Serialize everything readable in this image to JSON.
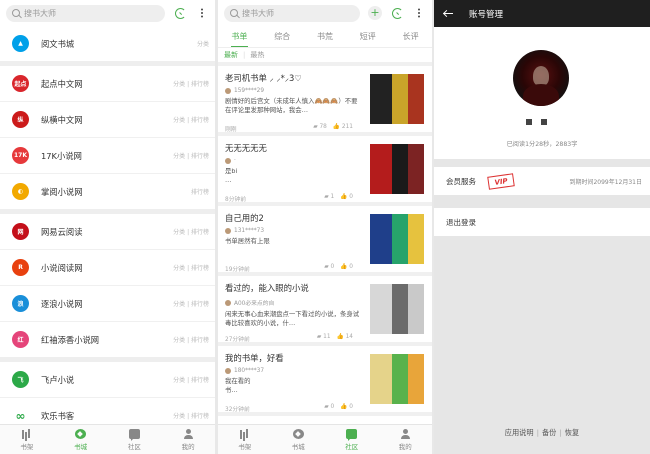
{
  "search_placeholder": "搜书大师",
  "panel1": {
    "sources": [
      {
        "name": "阅文书城",
        "tags": "分类",
        "color": "#00a0e9",
        "logo": "▲"
      },
      {
        "name": "起点中文网",
        "tags": "分类 | 排行榜",
        "color": "#d9262c",
        "logo": "起点"
      },
      {
        "name": "纵横中文网",
        "tags": "分类 | 排行榜",
        "color": "#cc1b1b",
        "logo": "纵"
      },
      {
        "name": "17K小说网",
        "tags": "分类 | 排行榜",
        "color": "#e6393b",
        "logo": "17K"
      },
      {
        "name": "掌阅小说网",
        "tags": "排行榜",
        "color": "#f2a900",
        "logo": "◐"
      },
      {
        "name": "网易云阅读",
        "tags": "分类 | 排行榜",
        "color": "#c40f1a",
        "logo": "网"
      },
      {
        "name": "小说阅读网",
        "tags": "分类 | 排行榜",
        "color": "#e8410f",
        "logo": "R"
      },
      {
        "name": "逐浪小说网",
        "tags": "分类 | 排行榜",
        "color": "#1a8fd9",
        "logo": "浪"
      },
      {
        "name": "红袖添香小说网",
        "tags": "分类 | 排行榜",
        "color": "#e5457a",
        "logo": "红"
      },
      {
        "name": "飞卢小说",
        "tags": "分类 | 排行榜",
        "color": "#2ca948",
        "logo": "飞"
      },
      {
        "name": "欢乐书客",
        "tags": "分类 | 排行榜",
        "color": "#ffffff",
        "logo": "∞"
      }
    ],
    "nav": [
      {
        "label": "书架",
        "icon": "shelf"
      },
      {
        "label": "书城",
        "icon": "city"
      },
      {
        "label": "社区",
        "icon": "comm"
      },
      {
        "label": "我的",
        "icon": "me"
      }
    ],
    "active_nav": 1
  },
  "panel2": {
    "tabs": [
      "书单",
      "综合",
      "书荒",
      "短评",
      "长评"
    ],
    "active_tab": 0,
    "subtabs": [
      "最新",
      "最热"
    ],
    "posts": [
      {
        "title": "老司机书单 ⸝ ⸝*⸝3♡",
        "user": "159****29",
        "desc": "剧情好的后宫文（未成年人慎入🙈🙈🙈）不要在评论里发那种网站，我会…",
        "time": "刚刚",
        "count1": "78",
        "count2": "211",
        "covers": [
          "#222",
          "#c9a42a",
          "#a9341f"
        ]
      },
      {
        "title": "无无无无无",
        "user": "·",
        "desc": "是bi\n…",
        "time": "8分钟前",
        "count1": "1",
        "count2": "0",
        "covers": [
          "#b41c1c",
          "#1a1a1a",
          "#7c2323"
        ]
      },
      {
        "title": "自己用的2",
        "user": "131****73",
        "desc": "书单居然有上限",
        "time": "19分钟前",
        "count1": "0",
        "count2": "0",
        "covers": [
          "#1f3f8a",
          "#27a36b",
          "#e6c23e"
        ]
      },
      {
        "title": "看过的，能入眼的小说",
        "user": "A00必来点的自",
        "desc": "闲来无事心血来潮盘点一下看过的小说，条身试毒比较喜欢的小说，什…",
        "time": "27分钟前",
        "count1": "11",
        "count2": "14",
        "covers": [
          "#d7d7d7",
          "#6b6b6b",
          "#c9c9c9"
        ]
      },
      {
        "title": "我的书单，好看",
        "user": "180****37",
        "desc": "我在看的\n书…",
        "time": "32分钟前",
        "count1": "0",
        "count2": "0",
        "covers": [
          "#e5d38a",
          "#59b24c",
          "#e8a53a"
        ]
      }
    ],
    "nav": [
      {
        "label": "书架",
        "icon": "shelf"
      },
      {
        "label": "书城",
        "icon": "city"
      },
      {
        "label": "社区",
        "icon": "comm"
      },
      {
        "label": "我的",
        "icon": "me"
      }
    ],
    "active_nav": 2
  },
  "panel3": {
    "title": "账号管理",
    "read_time": "已阅读1分28秒，2883字",
    "member_label": "会员服务",
    "vip_label": "VIP",
    "expire": "到期时间2099年12月31日",
    "logout": "退出登录",
    "links": [
      "应用说明",
      "备份",
      "恢复"
    ],
    "header_color": "#1f1f1f",
    "accent": "#4caf50"
  }
}
